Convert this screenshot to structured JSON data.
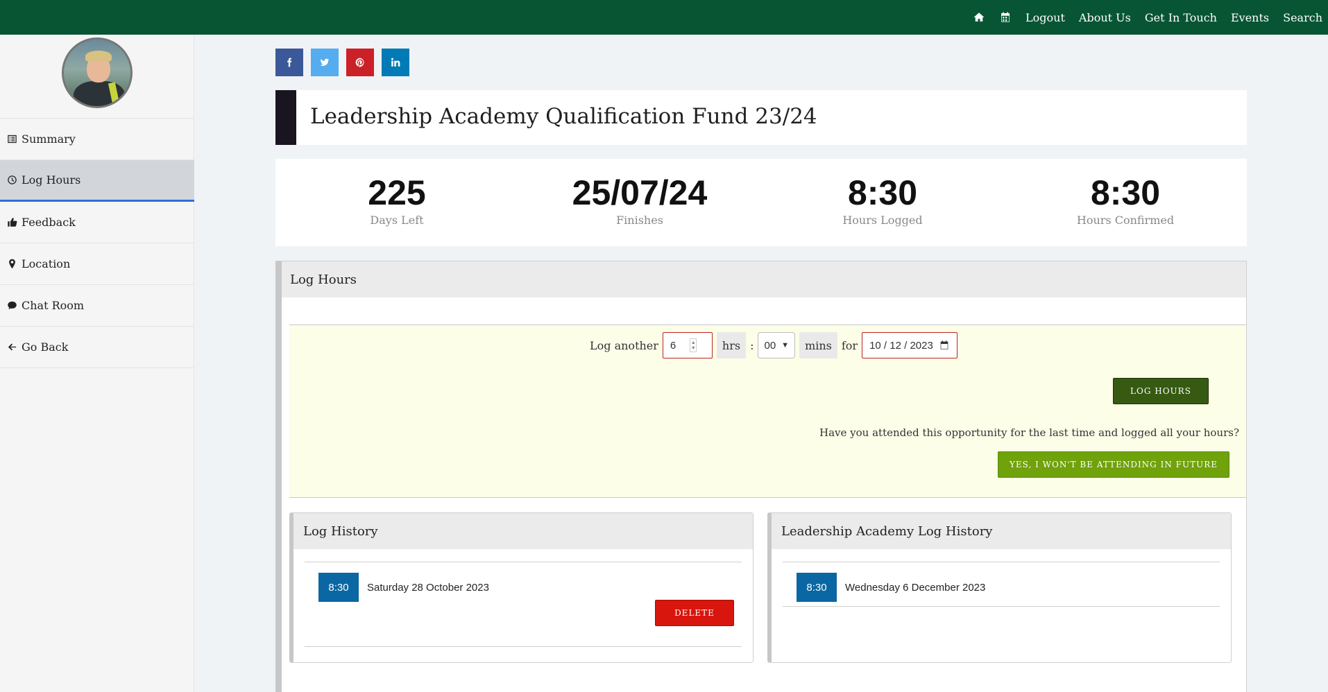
{
  "nav": {
    "home_icon": "home-icon",
    "calendar_icon": "calendar-icon",
    "links": [
      "Logout",
      "About Us",
      "Get In Touch",
      "Events",
      "Search"
    ]
  },
  "sidebar": {
    "items": [
      {
        "label": "Summary",
        "icon": "list-icon"
      },
      {
        "label": "Log Hours",
        "icon": "clock-icon",
        "active": true
      },
      {
        "label": "Feedback",
        "icon": "thumbs-up-icon"
      },
      {
        "label": "Location",
        "icon": "map-marker-icon"
      },
      {
        "label": "Chat Room",
        "icon": "chat-icon"
      },
      {
        "label": "Go Back",
        "icon": "arrow-left-icon"
      }
    ]
  },
  "social": [
    "facebook-icon",
    "twitter-icon",
    "pinterest-icon",
    "linkedin-icon"
  ],
  "title": "Leadership Academy Qualification Fund 23/24",
  "stats": [
    {
      "value": "225",
      "label": "Days Left"
    },
    {
      "value": "25/07/24",
      "label": "Finishes"
    },
    {
      "value": "8:30",
      "label": "Hours Logged"
    },
    {
      "value": "8:30",
      "label": "Hours Confirmed"
    }
  ],
  "log_panel": {
    "title": "Log Hours",
    "log_another_label": "Log another",
    "hours_value": "6",
    "hrs_label": "hrs",
    "colon": ":",
    "mins_value": "00",
    "mins_label": "mins",
    "for_label": "for",
    "date_value": "10 / 12 / 2023",
    "log_button": "LOG HOURS",
    "attend_question": "Have you attended this opportunity for the last time and logged all your hours?",
    "attend_button": "YES, I WON'T BE ATTENDING IN FUTURE"
  },
  "log_history": {
    "title": "Log History",
    "entries": [
      {
        "hours": "8:30",
        "date": "Saturday 28 October 2023"
      }
    ],
    "delete_button": "DELETE"
  },
  "academy_history": {
    "title": "Leadership Academy Log History",
    "entries": [
      {
        "hours": "8:30",
        "date": "Wednesday 6 December 2023"
      }
    ]
  },
  "colors": {
    "topbar": "#085534",
    "log_button": "#365a12",
    "attend_button": "#6fa20b",
    "delete_button": "#d8160e",
    "badge": "#0a67a3"
  }
}
